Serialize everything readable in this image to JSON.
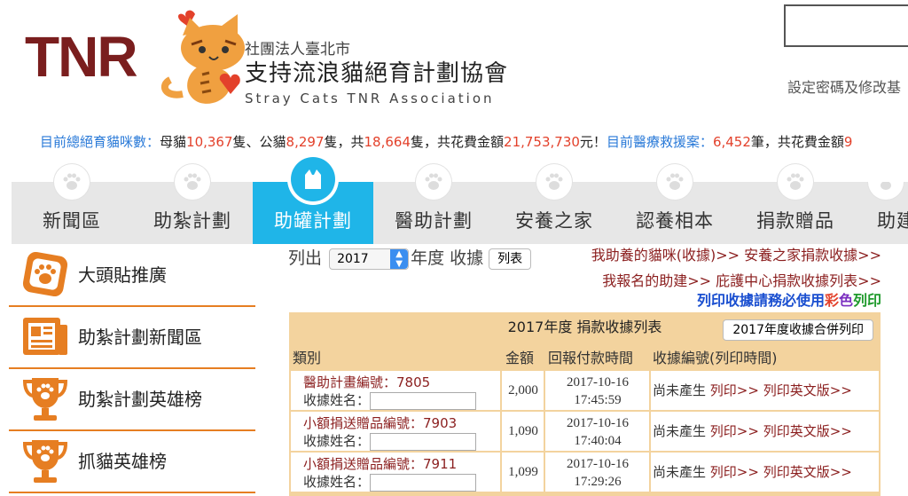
{
  "header": {
    "logo_letters": "TNR",
    "org_type": "社團法人臺北市",
    "org_name": "支持流浪貓絕育計劃協會",
    "org_name_en": "Stray Cats TNR Association",
    "settings_link": "設定密碼及修改基"
  },
  "stats": {
    "label_total": "目前總絕育貓咪數：",
    "female_label": "母貓",
    "female_count": "10,367",
    "unit1": "隻、公貓",
    "male_count": "8,297",
    "unit2": "隻，共",
    "total_count": "18,664",
    "unit3": "隻，共花費金額",
    "total_cost": "21,753,730",
    "unit4": "元！",
    "medical_label": "目前醫療救援案：",
    "medical_count": "6,452",
    "unit5": "筆，共花費金額",
    "medical_cost_partial": "9"
  },
  "nav": {
    "items": [
      {
        "label": "新聞區"
      },
      {
        "label": "助紮計劃"
      },
      {
        "label": "助罐計劃"
      },
      {
        "label": "醫助計劃"
      },
      {
        "label": "安養之家"
      },
      {
        "label": "認養相本"
      },
      {
        "label": "捐款贈品"
      },
      {
        "label": "助建"
      }
    ],
    "active_index": 2,
    "active_color": "#1fb5e8"
  },
  "sidebar": {
    "items": [
      {
        "label": "大頭貼推廣",
        "icon": "paw-badge-icon"
      },
      {
        "label": "助紮計劃新聞區",
        "icon": "newspaper-icon"
      },
      {
        "label": "助紮計劃英雄榜",
        "icon": "trophy-icon"
      },
      {
        "label": "抓貓英雄榜",
        "icon": "trophy-icon"
      }
    ],
    "accent_color": "#e67e22"
  },
  "toolbar": {
    "list_prefix": "列出",
    "year_value": "2017",
    "year_suffix": "年度 收據",
    "list_button": "列表"
  },
  "links": {
    "adopted_receipts": "我助養的貓咪(收據)>>",
    "shelter_receipts": "安養之家捐款收據>>",
    "registered_projects": "我報名的助建>>",
    "center_receipts": "庇護中心捐款收據列表>>"
  },
  "print_note": {
    "prefix": "列印收據請務必使用",
    "color_1": "彩",
    "color_2": "色",
    "suffix": "列印"
  },
  "table": {
    "title": "2017年度 捐款收據列表",
    "merge_print_button": "2017年度收據合併列印",
    "columns": [
      "類別",
      "金額",
      "回報付款時間",
      "收據編號(列印時間)"
    ],
    "recipient_label": "收據姓名：",
    "rows": [
      {
        "project": "醫助計畫編號：7805",
        "amount": "2,000",
        "date": "2017-10-16",
        "time": "17:45:59",
        "status": "尚未產生",
        "print": "列印>>",
        "print_en": "列印英文版>>"
      },
      {
        "project": "小額捐送贈品編號：7903",
        "amount": "1,090",
        "date": "2017-10-16",
        "time": "17:40:04",
        "status": "尚未產生",
        "print": "列印>>",
        "print_en": "列印英文版>>"
      },
      {
        "project": "小額捐送贈品編號：7911",
        "amount": "1,099",
        "date": "2017-10-16",
        "time": "17:29:26",
        "status": "尚未產生",
        "print": "列印>>",
        "print_en": "列印英文版>>"
      }
    ]
  }
}
